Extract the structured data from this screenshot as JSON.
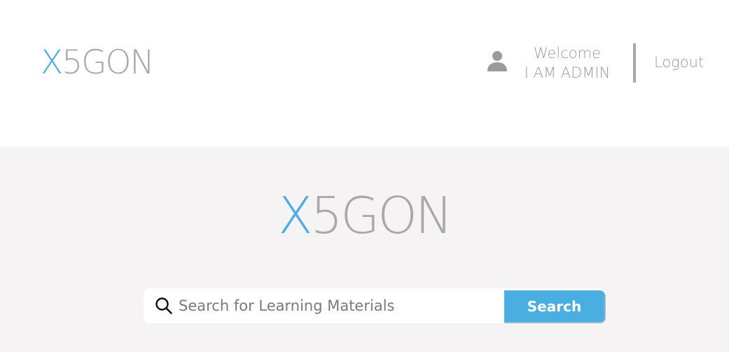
{
  "header": {
    "logo": {
      "accent": "X",
      "rest": "5GON"
    },
    "user": {
      "icon": "user-icon",
      "welcome_label": "Welcome",
      "username": "I AM ADMIN"
    },
    "logout_label": "Logout"
  },
  "hero": {
    "logo": {
      "accent": "X",
      "rest": "5GON"
    },
    "search": {
      "icon": "search-icon",
      "placeholder": "Search for Learning Materials",
      "value": "",
      "button_label": "Search"
    }
  },
  "colors": {
    "accent": "#4aaee0",
    "logo_gray": "#a8a8a8",
    "hero_background": "#f5f3f4"
  }
}
